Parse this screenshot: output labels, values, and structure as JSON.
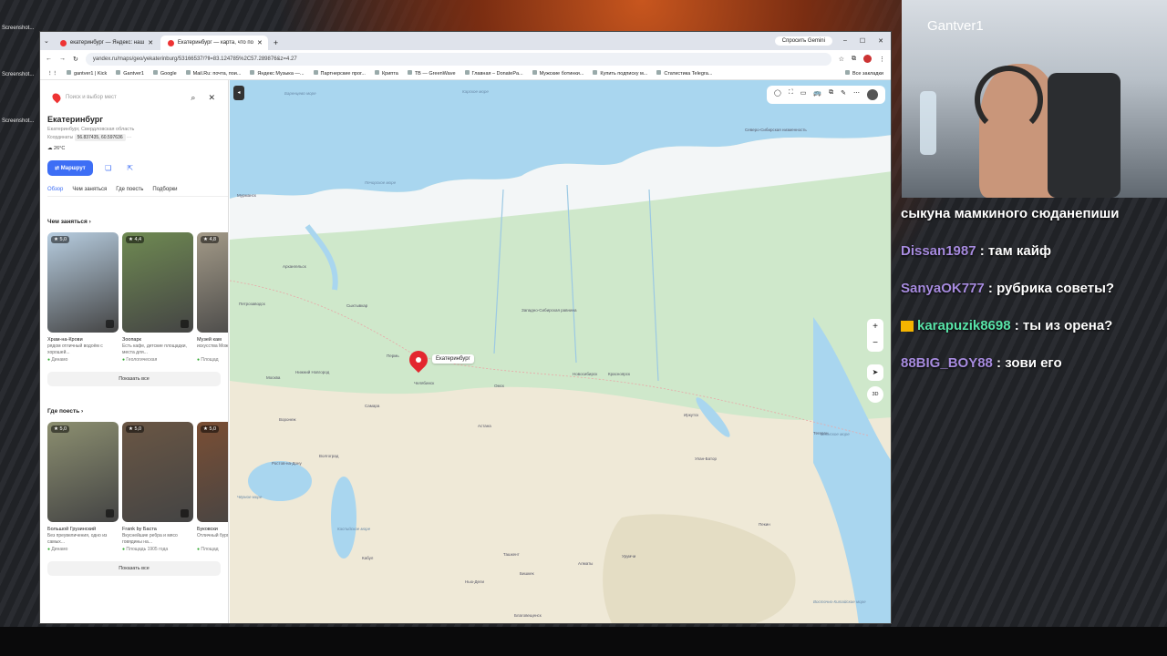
{
  "desktop": {
    "icons": [
      "Screenshot...",
      "Screenshot...",
      "Screenshot..."
    ]
  },
  "browser": {
    "tabs": [
      {
        "title": "екатеринбург — Яндекс: наш",
        "active": false
      },
      {
        "title": "Екатеринбург — карта, что по",
        "active": true
      }
    ],
    "new_tab": "+",
    "gemini": "Спросить Gemini",
    "window_controls": [
      "–",
      "☐",
      "✕"
    ],
    "url": "yandex.ru/maps/geo/yekaterinburg/53166537/?ll=83.124785%2C57.289876&z=4.27",
    "bookmarks": [
      "gantver1 | Kick",
      "Gantver1",
      "Google",
      "Mail.Ru: почта, пои...",
      "Яндекс Музыка —...",
      "Партнерские прог...",
      "Крипта",
      "TB — GreenWave",
      "Главная – DonatePa...",
      "Мужские ботинки...",
      "Купить подписку м...",
      "Статистика Telegra..."
    ],
    "all_bookmarks": "Все закладки"
  },
  "panel": {
    "search_placeholder": "Поиск и выбор мест",
    "city": "Екатеринбург",
    "region": "Екатеринбург, Свердловская область",
    "coords_label": "Координаты",
    "coords": "56.837435, 60.597636",
    "coords_more": "···",
    "weather": "26°C",
    "route": "Маршрут",
    "tabs": [
      "Обзор",
      "Чем заняться",
      "Где поесть",
      "Подборки"
    ],
    "section1": "Чем заняться",
    "cards1": [
      {
        "rating": "★ 5,0",
        "title": "Храм-на-Крови",
        "desc": "рядом отличный водоём с хорошей...",
        "meta": "Динамо",
        "color": "#b7cde0"
      },
      {
        "rating": "★ 4,4",
        "title": "Зоопарк",
        "desc": "Есть кафе, детские площадки, места для...",
        "meta": "Геологическая",
        "color": "#6f8a52"
      },
      {
        "rating": "★ 4,8",
        "title": "Музей кам",
        "desc": "искусства Можно по с детьми и д",
        "meta": "Площад",
        "color": "#a39a88"
      }
    ],
    "show_all": "Показать все",
    "section2": "Где поесть",
    "cards2": [
      {
        "rating": "★ 5,0",
        "title": "Большой Грузинский",
        "desc": "Без преувеличения, одно из самых...",
        "meta": "Динамо",
        "color": "#8c8f70"
      },
      {
        "rating": "★ 5,0",
        "title": "Frank by Баста",
        "desc": "Вкуснейшие ребра и мясо говядины на...",
        "meta": "Площадь 1905 года",
        "color": "#6a5644"
      },
      {
        "rating": "★ 5,0",
        "title": "Буковски",
        "desc": "Отличный бургеры в крутых атм",
        "meta": "Площад",
        "color": "#7a4e34"
      }
    ],
    "show_all_2": "Показать все"
  },
  "map": {
    "pin_label": "Екатеринбург",
    "tools": [
      "◯",
      "⛶",
      "▭",
      "🚌",
      "⧉",
      "✎",
      "⋯"
    ],
    "zoom_in": "+",
    "zoom_out": "−",
    "geo": "➤",
    "mode3d": "3D",
    "labels": [
      {
        "t": "Баренцево море",
        "sea": true
      },
      {
        "t": "Карское море",
        "sea": true
      },
      {
        "t": "Северо-Сибирская низменность",
        "sea": false
      },
      {
        "t": "Печорское море",
        "sea": true
      },
      {
        "t": "Мурманск",
        "sea": false
      },
      {
        "t": "Архангельск",
        "sea": false
      },
      {
        "t": "Петрозаводск",
        "sea": false
      },
      {
        "t": "Сыктывкар",
        "sea": false
      },
      {
        "t": "Западно-Сибирская равнина",
        "sea": false
      },
      {
        "t": "Пермь",
        "sea": false
      },
      {
        "t": "Нижний Новгород",
        "sea": false
      },
      {
        "t": "Москва",
        "sea": false
      },
      {
        "t": "Челябинск",
        "sea": false
      },
      {
        "t": "Омск",
        "sea": false
      },
      {
        "t": "Новосибирск",
        "sea": false
      },
      {
        "t": "Красноярск",
        "sea": false
      },
      {
        "t": "Иркутск",
        "sea": false
      },
      {
        "t": "Воронеж",
        "sea": false
      },
      {
        "t": "Самара",
        "sea": false
      },
      {
        "t": "Астана",
        "sea": false
      },
      {
        "t": "Ростов-на-Дону",
        "sea": false
      },
      {
        "t": "Волгоград",
        "sea": false
      },
      {
        "t": "Чёрное море",
        "sea": true
      },
      {
        "t": "Каспийское море",
        "sea": true
      },
      {
        "t": "Ташкент",
        "sea": false
      },
      {
        "t": "Бишкек",
        "sea": false
      },
      {
        "t": "Алматы",
        "sea": false
      },
      {
        "t": "Урумчи",
        "sea": false
      },
      {
        "t": "Улан-Батор",
        "sea": false
      },
      {
        "t": "Пекин",
        "sea": false
      },
      {
        "t": "Тегеран",
        "sea": false
      },
      {
        "t": "Кабул",
        "sea": false
      },
      {
        "t": "Нью-Дели",
        "sea": false
      },
      {
        "t": "Благовещенск",
        "sea": false
      },
      {
        "t": "Японское море",
        "sea": true
      },
      {
        "t": "Восточно-Китайское море",
        "sea": true
      }
    ]
  },
  "stream": {
    "name": "Gantver1",
    "chat": [
      {
        "user": "",
        "text": "сыкуна мамкиного сюданепиши",
        "green": false,
        "badge": false
      },
      {
        "user": "Dissan1987",
        "text": "там кайф",
        "green": false,
        "badge": false
      },
      {
        "user": "SanyaOK777",
        "text": "рубрика советы?",
        "green": false,
        "badge": false
      },
      {
        "user": "karapuzik8698",
        "text": "ты из орена?",
        "green": true,
        "badge": true
      },
      {
        "user": "88BIG_BOY88",
        "text": "зови его",
        "green": false,
        "badge": false
      }
    ]
  }
}
